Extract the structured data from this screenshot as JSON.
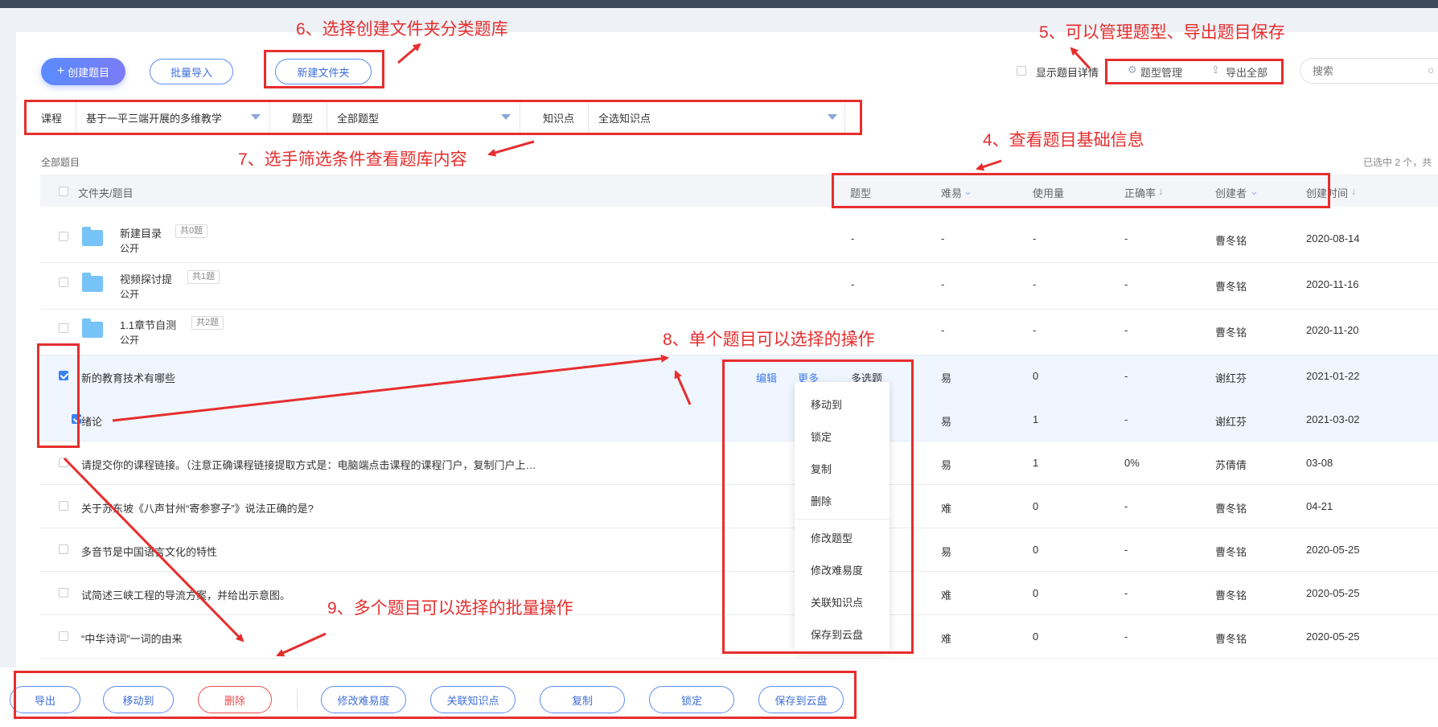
{
  "toolbar": {
    "create_label": "创建题目",
    "batch_import_label": "批量导入",
    "new_folder_label": "新建文件夹",
    "show_detail_label": "显示题目详情",
    "type_manage_label": "题型管理",
    "export_all_label": "导出全部",
    "search_placeholder": "搜索"
  },
  "filters": {
    "course_label": "课程",
    "course_value": "基于一平三端开展的多维教学",
    "type_label": "题型",
    "type_value": "全部题型",
    "kp_label": "知识点",
    "kp_value": "全选知识点"
  },
  "breadcrumb": "全部题目",
  "selection_text": "已选中 2 个，共",
  "columns": {
    "name": "文件夹/题目",
    "type": "题型",
    "difficulty": "难易",
    "usage": "使用量",
    "accuracy": "正确率",
    "creator": "创建者",
    "created": "创建时间"
  },
  "rows": [
    {
      "name": "新建目录",
      "count": "共0题",
      "sub": "公开",
      "type": "-",
      "difficulty": "-",
      "usage": "-",
      "accuracy": "-",
      "creator": "曹冬铭",
      "date": "2020-08-14"
    },
    {
      "name": "视频探讨提",
      "count": "共1题",
      "sub": "公开",
      "type": "-",
      "difficulty": "-",
      "usage": "-",
      "accuracy": "-",
      "creator": "曹冬铭",
      "date": "2020-11-16"
    },
    {
      "name": "1.1章节自测",
      "count": "共2题",
      "sub": "公开",
      "type": "-",
      "difficulty": "-",
      "usage": "-",
      "accuracy": "-",
      "creator": "曹冬铭",
      "date": "2020-11-20"
    },
    {
      "name": "新的教育技术有哪些",
      "type": "多选题",
      "difficulty": "易",
      "usage": "0",
      "accuracy": "-",
      "creator": "谢红芬",
      "date": "2021-01-22"
    },
    {
      "name": "绪论",
      "difficulty": "易",
      "usage": "1",
      "accuracy": "-",
      "creator": "谢红芬",
      "date": "2021-03-02"
    },
    {
      "name": "请提交你的课程链接。（注意正确课程链接提取方式是：电脑端点击课程的课程门户，复制门户上…",
      "difficulty": "易",
      "usage": "1",
      "accuracy": "0%",
      "creator": "苏倩倩",
      "date": "03-08"
    },
    {
      "name": "关于苏东坡《八声甘州“寄参寥子”》说法正确的是?",
      "difficulty": "难",
      "usage": "0",
      "accuracy": "-",
      "creator": "曹冬铭",
      "date": "04-21"
    },
    {
      "name": "多音节是中国语言文化的特性",
      "difficulty": "易",
      "usage": "0",
      "accuracy": "-",
      "creator": "曹冬铭",
      "date": "2020-05-25"
    },
    {
      "name": "试简述三峡工程的导流方案，并给出示意图。",
      "difficulty": "难",
      "usage": "0",
      "accuracy": "-",
      "creator": "曹冬铭",
      "date": "2020-05-25"
    },
    {
      "name": "“中华诗词”一词的由来",
      "difficulty": "难",
      "usage": "0",
      "accuracy": "-",
      "creator": "曹冬铭",
      "date": "2020-05-25"
    }
  ],
  "row_actions": {
    "edit": "编辑",
    "more": "更多"
  },
  "more_menu": [
    "移动到",
    "锁定",
    "复制",
    "删除",
    "修改题型",
    "修改难易度",
    "关联知识点",
    "保存到云盘"
  ],
  "bottom_actions": [
    "导出",
    "移动到",
    "删除",
    "修改难易度",
    "关联知识点",
    "复制",
    "锁定",
    "保存到云盘"
  ],
  "annotations": {
    "a4": "4、查看题目基础信息",
    "a5": "5、可以管理题型、导出题目保存",
    "a6": "6、选择创建文件夹分类题库",
    "a7": "7、选手筛选条件查看题库内容",
    "a8": "8、单个题目可以选择的操作",
    "a9": "9、多个题目可以选择的批量操作"
  }
}
